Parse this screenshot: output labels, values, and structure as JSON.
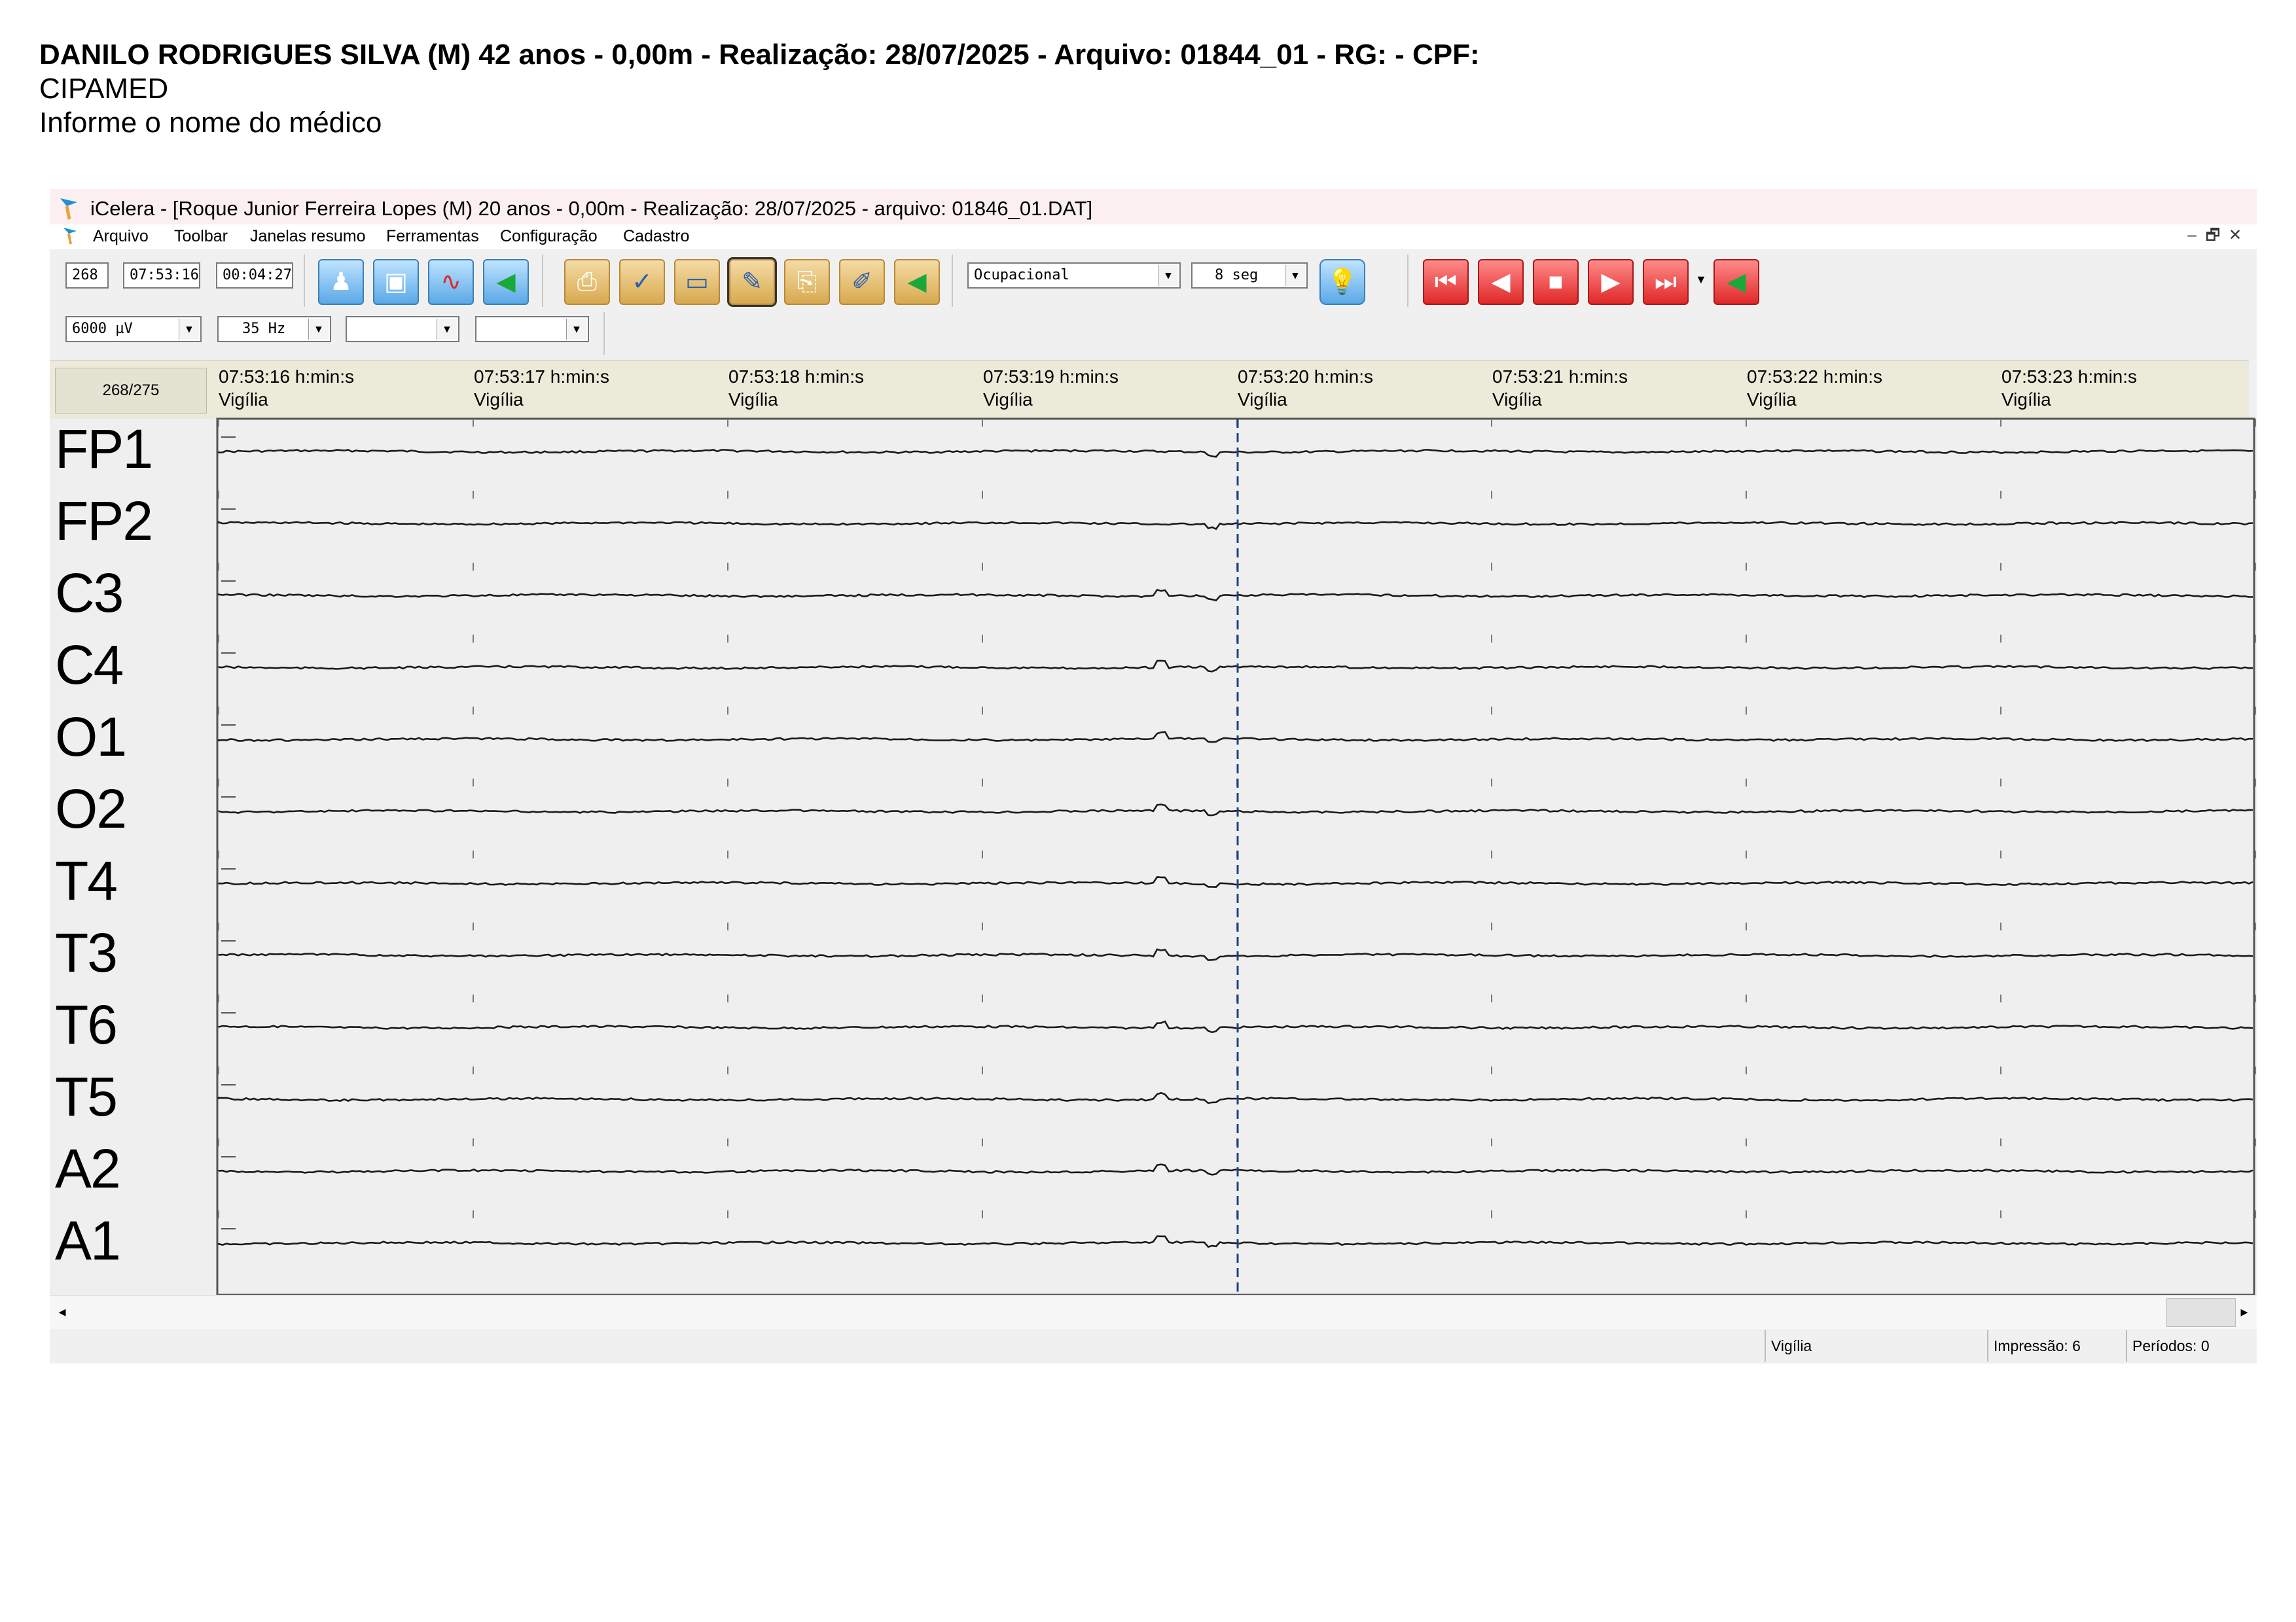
{
  "report": {
    "title": "DANILO RODRIGUES SILVA (M) 42 anos - 0,00m - Realização: 28/07/2025 - Arquivo: 01844_01 - RG:  - CPF:",
    "clinic": "CIPAMED",
    "doctor_prompt": "Informe o nome do médico"
  },
  "window": {
    "title": "iCelera - [Roque Junior Ferreira Lopes (M) 20 anos - 0,00m  -  Realização: 28/07/2025  -  arquivo: 01846_01.DAT]",
    "menu": [
      "Arquivo",
      "Toolbar",
      "Janelas resumo",
      "Ferramentas",
      "Configuração",
      "Cadastro"
    ],
    "controls": [
      "–",
      "🗗",
      "✕"
    ]
  },
  "toolbar": {
    "page": "268",
    "time": "07:53:16",
    "elapsed": "00:04:27",
    "sensitivity": "6000 µV",
    "filter": "35 Hz",
    "combo3": "",
    "combo4": "",
    "mode": "Ocupacional",
    "window_length": "8 seg"
  },
  "chart": {
    "page_counter": "268/275",
    "times": [
      "07:53:16 h:min:s",
      "07:53:17 h:min:s",
      "07:53:18 h:min:s",
      "07:53:19 h:min:s",
      "07:53:20 h:min:s",
      "07:53:21 h:min:s",
      "07:53:22 h:min:s",
      "07:53:23 h:min:s"
    ],
    "stage": "Vigília"
  },
  "chart_data": {
    "type": "line",
    "title": "",
    "x_start": "07:53:16",
    "x_end": "07:53:24",
    "channels": [
      "FP1",
      "FP2",
      "C3",
      "C4",
      "O1",
      "O2",
      "T4",
      "T3",
      "T6",
      "T5",
      "A2",
      "A1"
    ],
    "cursor_time": "07:53:20"
  },
  "status": {
    "stage": "Vigília",
    "print": "Impressão: 6",
    "periods": "Períodos: 0"
  }
}
